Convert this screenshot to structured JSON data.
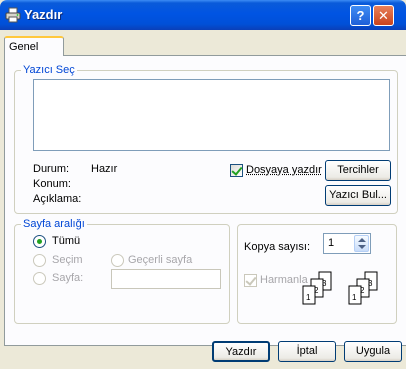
{
  "window": {
    "title": "Yazdır",
    "help_glyph": "?",
    "close_glyph": "✕"
  },
  "tabs": [
    {
      "label": "Genel",
      "active": true
    }
  ],
  "printer_group": {
    "label": "Yazıcı Seç",
    "status_label": "Durum:",
    "status_value": "Hazır",
    "location_label": "Konum:",
    "comment_label": "Açıklama:",
    "print_to_file_label": "Dosyaya yazdır",
    "print_to_file_checked": true,
    "preferences_button": "Tercihler",
    "find_printer_button": "Yazıcı Bul..."
  },
  "page_range_group": {
    "label": "Sayfa aralığı",
    "options": [
      {
        "label": "Tümü",
        "selected": true,
        "enabled": true
      },
      {
        "label": "Seçim",
        "selected": false,
        "enabled": false
      },
      {
        "label": "Geçerli sayfa",
        "selected": false,
        "enabled": false
      },
      {
        "label": "Sayfa:",
        "selected": false,
        "enabled": false
      }
    ],
    "pages_value": ""
  },
  "copies_group": {
    "copies_label": "Kopya sayısı:",
    "copies_value": "1",
    "collate_label": "Harmanla",
    "collate_checked": true,
    "collate_pages": [
      "1",
      "2",
      "3"
    ]
  },
  "footer": {
    "print_button": "Yazdır",
    "cancel_button": "İptal",
    "apply_button": "Uygula"
  },
  "icons": {
    "title": "printer-icon"
  }
}
